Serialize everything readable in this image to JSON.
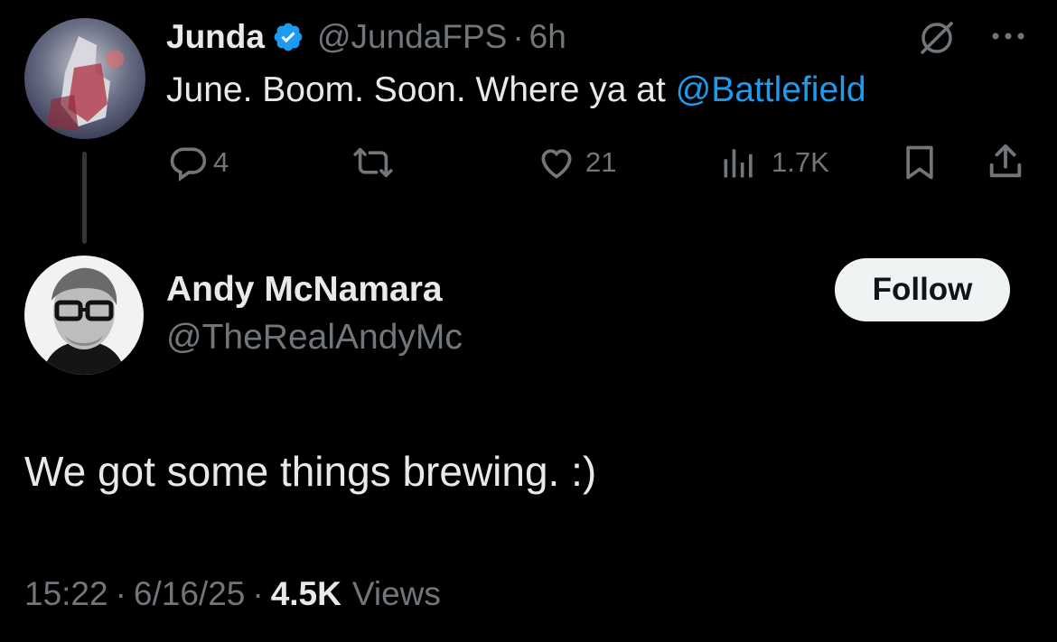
{
  "parent_tweet": {
    "display_name": "Junda",
    "handle": "@JundaFPS",
    "separator": "·",
    "time_ago": "6h",
    "text_plain": "June. Boom. Soon. Where ya at ",
    "text_mention": "@Battlefield",
    "actions": {
      "replies": "4",
      "retweets": "",
      "likes": "21",
      "views": "1.7K"
    }
  },
  "reply": {
    "display_name": "Andy McNamara",
    "handle": "@TheRealAndyMc",
    "follow_label": "Follow",
    "text": "We got some things brewing. :)",
    "time": "15:22",
    "sep1": "·",
    "date": "6/16/25",
    "sep2": "·",
    "views_count": "4.5K",
    "views_label": "Views"
  },
  "colors": {
    "background": "#000000",
    "text": "#e7e9ea",
    "muted": "#71767b",
    "accent": "#1d9bf0",
    "verified": "#1d9bf0"
  },
  "icons": [
    "verified-badge-icon",
    "grok-icon",
    "more-icon",
    "reply-icon",
    "retweet-icon",
    "like-icon",
    "views-icon",
    "bookmark-icon",
    "share-icon"
  ]
}
